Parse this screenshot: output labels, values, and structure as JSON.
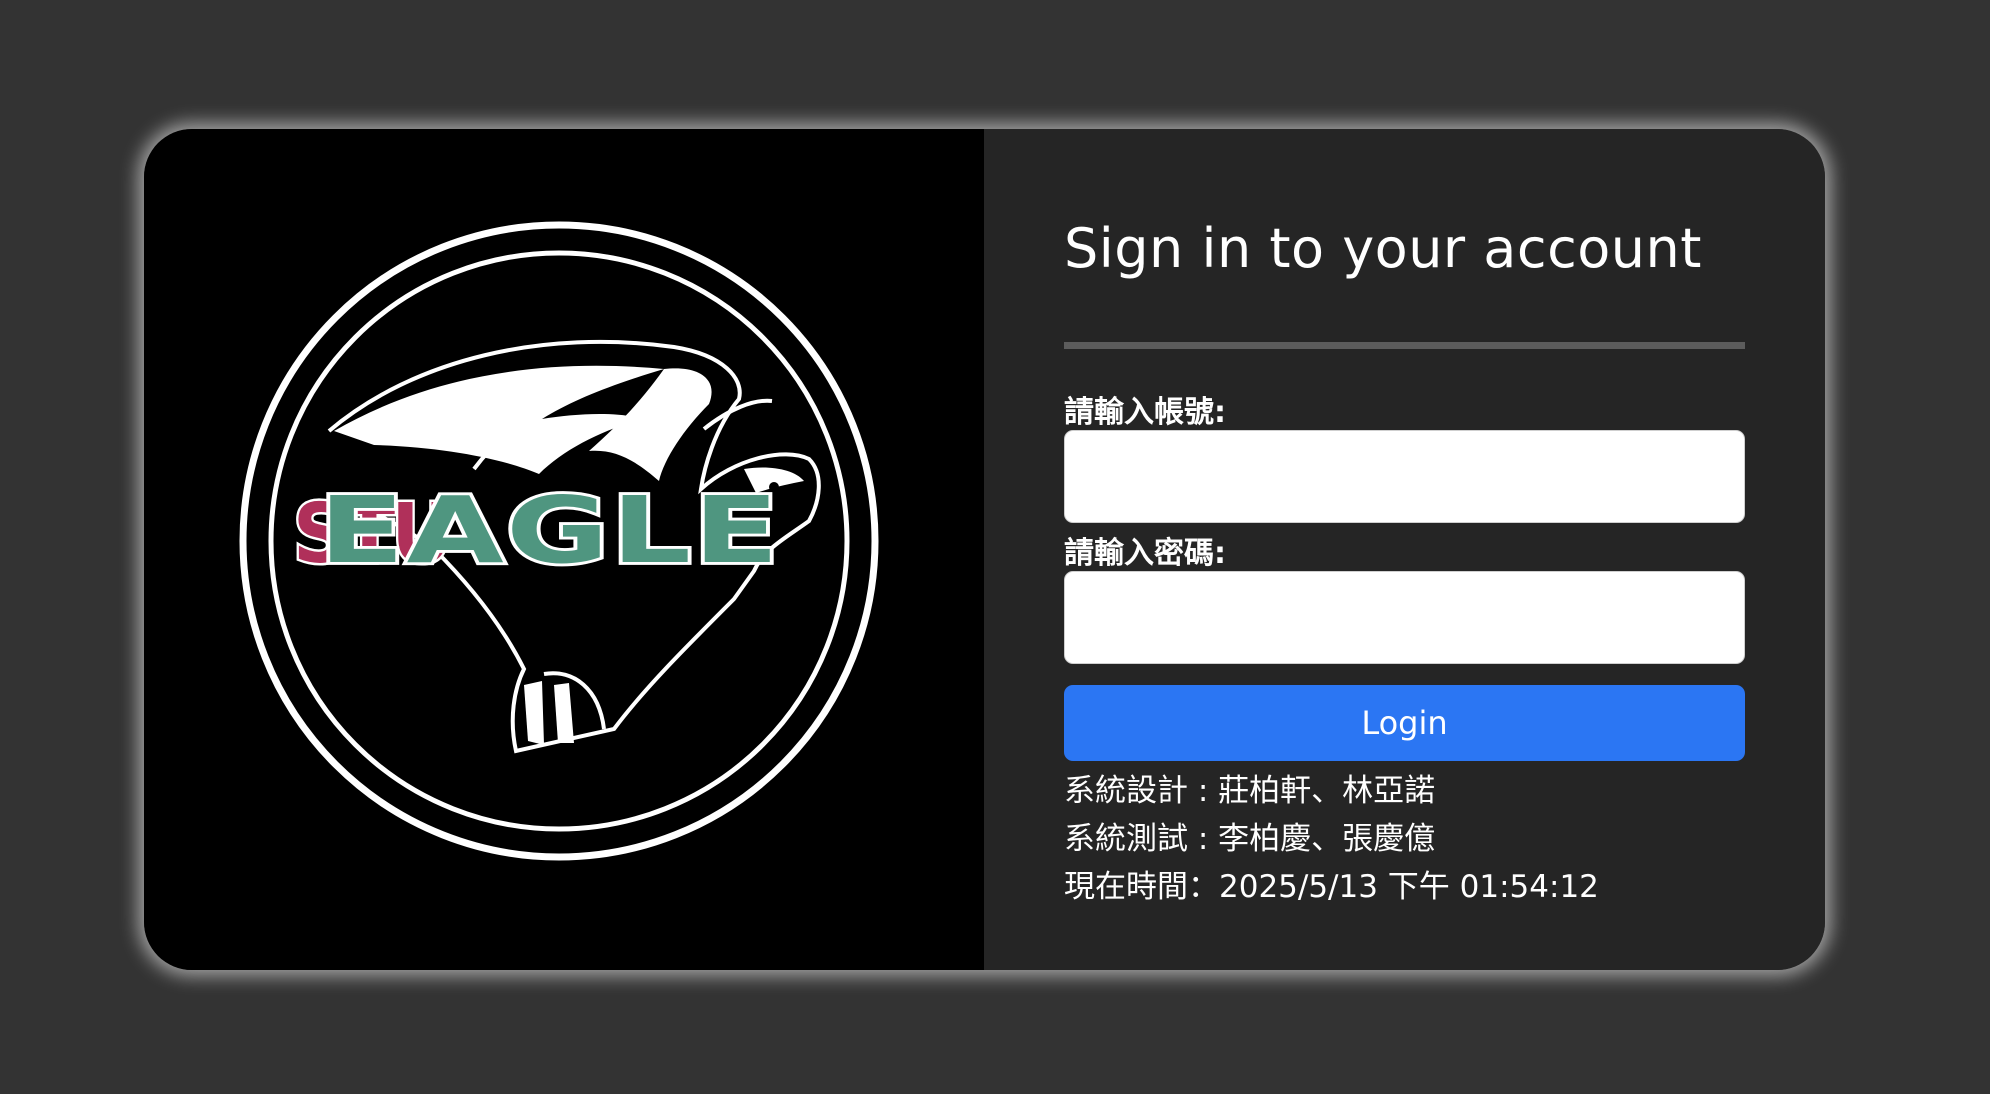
{
  "logo": {
    "small_text": "STU",
    "large_text": "EAGLE",
    "colors": {
      "small_text": "#b0305a",
      "large_text": "#4f9680",
      "ring": "#ffffff",
      "background": "#000000"
    }
  },
  "login_form": {
    "title": "Sign in to your account",
    "username_label": "請輸入帳號:",
    "username_value": "",
    "password_label": "請輸入密碼:",
    "password_value": "",
    "login_button": "Login"
  },
  "credits": {
    "design": "系統設計 : 莊柏軒、林亞諾",
    "testing": "系統測試 : 李柏慶、張慶億",
    "current_time": "現在時間：2025/5/13 下午 01:54:12"
  },
  "colors": {
    "page_background": "#333333",
    "panel_background": "#252525",
    "button": "#2b76f3"
  }
}
